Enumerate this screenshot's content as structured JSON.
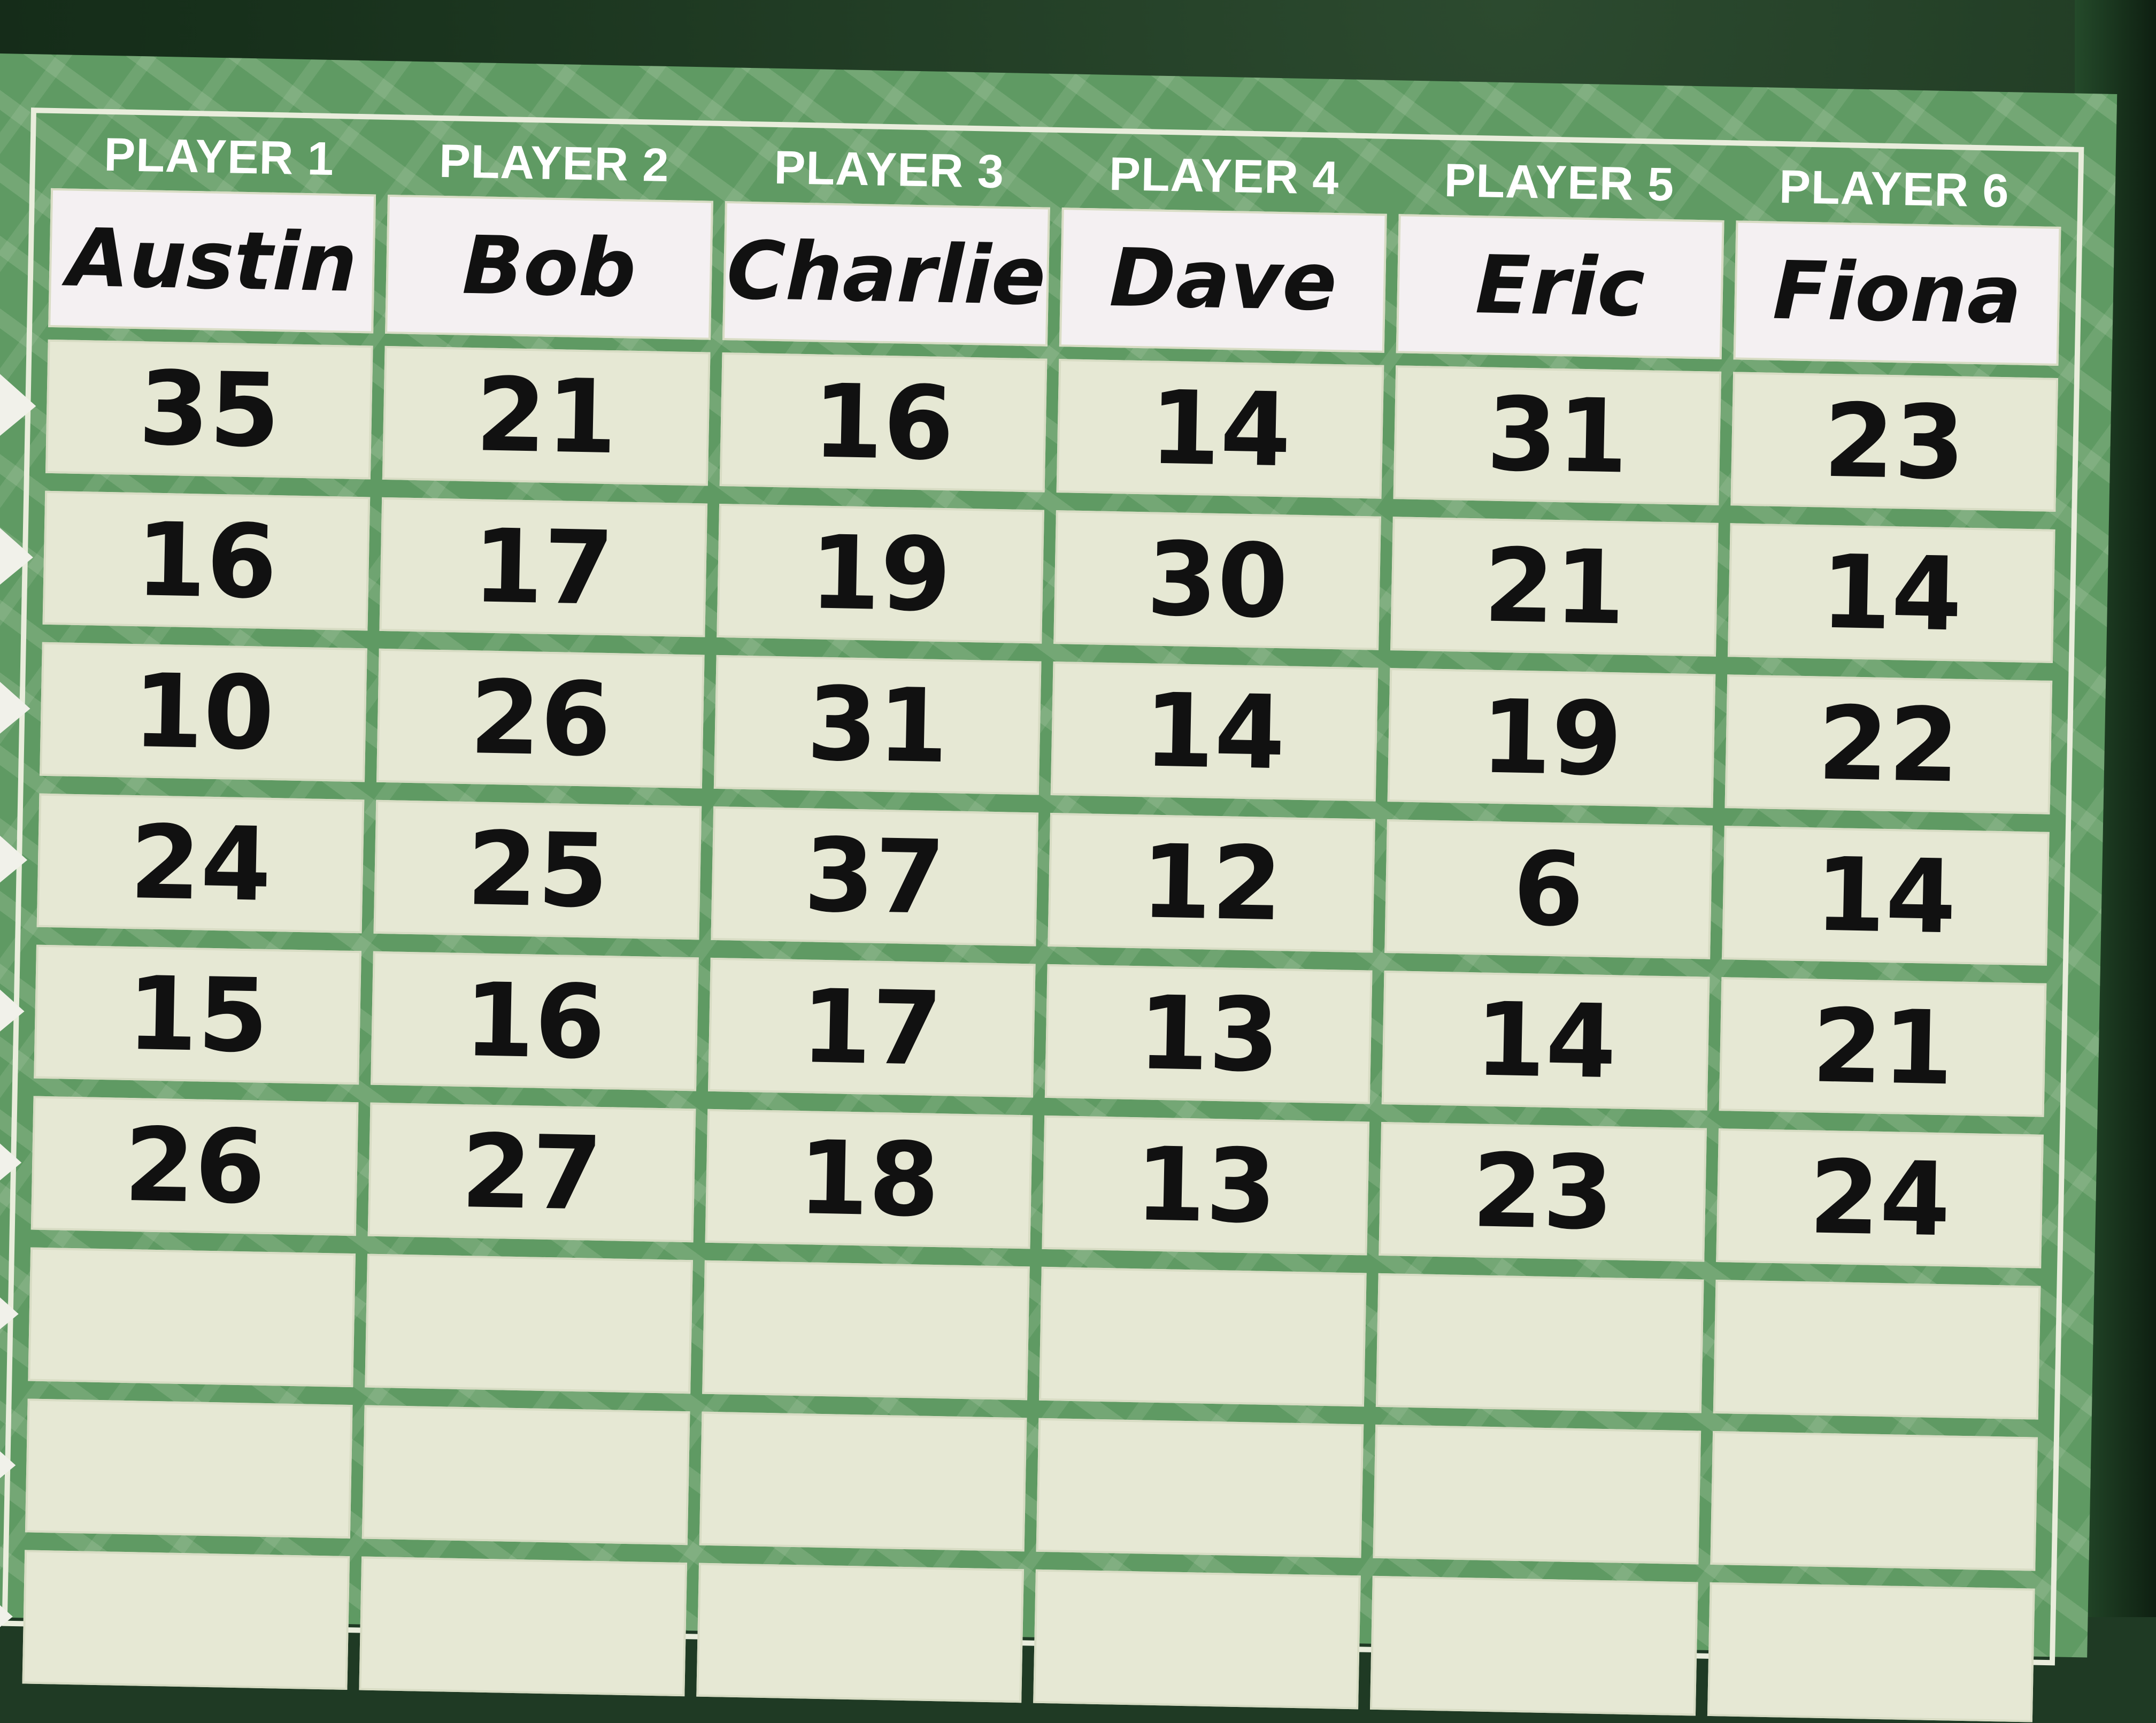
{
  "scoreboard": {
    "players": [
      {
        "label": "PLAYER 1",
        "name": "Austin",
        "scores": [
          "35",
          "16",
          "10",
          "24",
          "15",
          "26"
        ]
      },
      {
        "label": "PLAYER 2",
        "name": "Bob",
        "scores": [
          "21",
          "17",
          "26",
          "25",
          "16",
          "27"
        ]
      },
      {
        "label": "PLAYER 3",
        "name": "Charlie",
        "scores": [
          "16",
          "19",
          "31",
          "37",
          "17",
          "18"
        ]
      },
      {
        "label": "PLAYER 4",
        "name": "Dave",
        "scores": [
          "14",
          "30",
          "14",
          "12",
          "13",
          "13"
        ]
      },
      {
        "label": "PLAYER 5",
        "name": "Eric",
        "scores": [
          "31",
          "21",
          "19",
          "6",
          "14",
          "23"
        ]
      },
      {
        "label": "PLAYER 6",
        "name": "Fiona",
        "scores": [
          "23",
          "14",
          "22",
          "14",
          "21",
          "24"
        ]
      }
    ],
    "empty_rows": 3
  },
  "colors": {
    "board_green": "#5f9a63",
    "cell_cream": "#e6e8d4",
    "name_cell": "#f4f0f2",
    "ink": "#111111",
    "header_text": "#ffffff"
  }
}
